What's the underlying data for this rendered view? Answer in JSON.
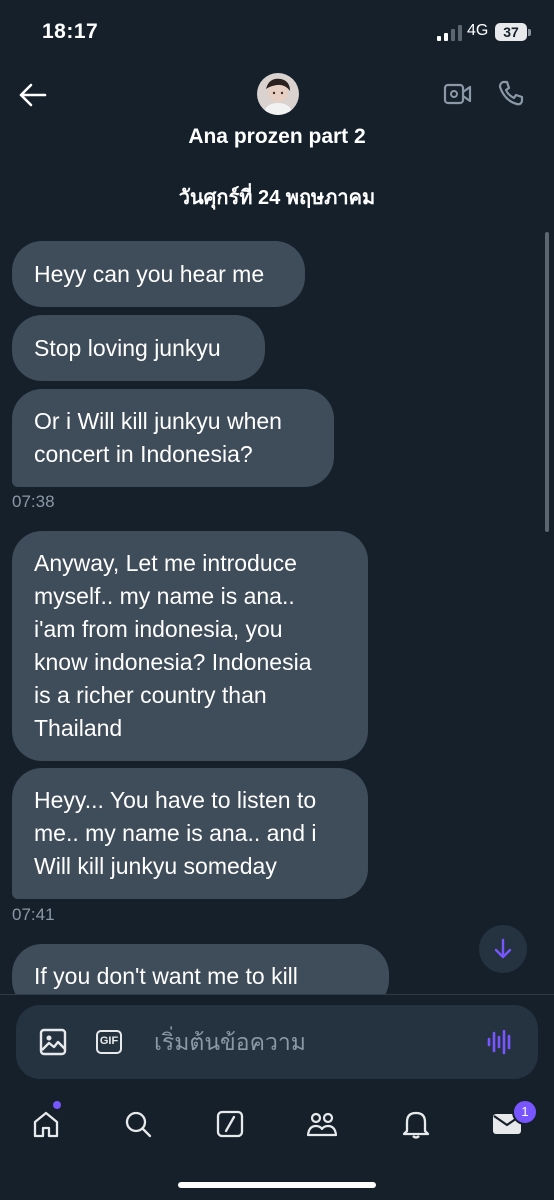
{
  "status_bar": {
    "time": "18:17",
    "network": "4G",
    "battery": "37"
  },
  "header": {
    "title": "Ana prozen part 2",
    "avatar_icon": "avatar-photo-icon",
    "back_icon": "arrow-left-icon",
    "video_icon": "video-call-icon",
    "call_icon": "phone-icon"
  },
  "conversation": {
    "date_label": "วันศุกร์ที่ 24 พฤษภาคม",
    "messages": [
      {
        "text": "Heyy can you hear me"
      },
      {
        "text": "Stop loving junkyu"
      },
      {
        "text": "Or i Will kill junkyu when\nconcert in Indonesia?"
      },
      {
        "text": "Anyway, Let me introduce\nmyself.. my name is ana..\ni'am from indonesia, you\nknow indonesia? Indonesia\nis a richer country than\nThailand"
      },
      {
        "text": "Heyy... You have to listen to\nme.. my name is ana.. and i\nWill kill junkyu someday"
      },
      {
        "text": "If you don't want me to kill"
      }
    ],
    "timestamps": [
      "07:38",
      "07:41"
    ]
  },
  "composer": {
    "placeholder": "เริ่มต้นข้อความ",
    "gif_label": "GIF",
    "image_icon": "image-icon",
    "voice_icon": "voice-wave-icon"
  },
  "nav": {
    "items": [
      "home-icon",
      "search-icon",
      "compose-icon",
      "communities-icon",
      "bell-icon",
      "mail-icon"
    ],
    "messages_badge": "1"
  },
  "colors": {
    "background": "#15202b",
    "bubble": "#3f4c59",
    "accent": "#7856ff",
    "muted_text": "#8b98a5"
  }
}
